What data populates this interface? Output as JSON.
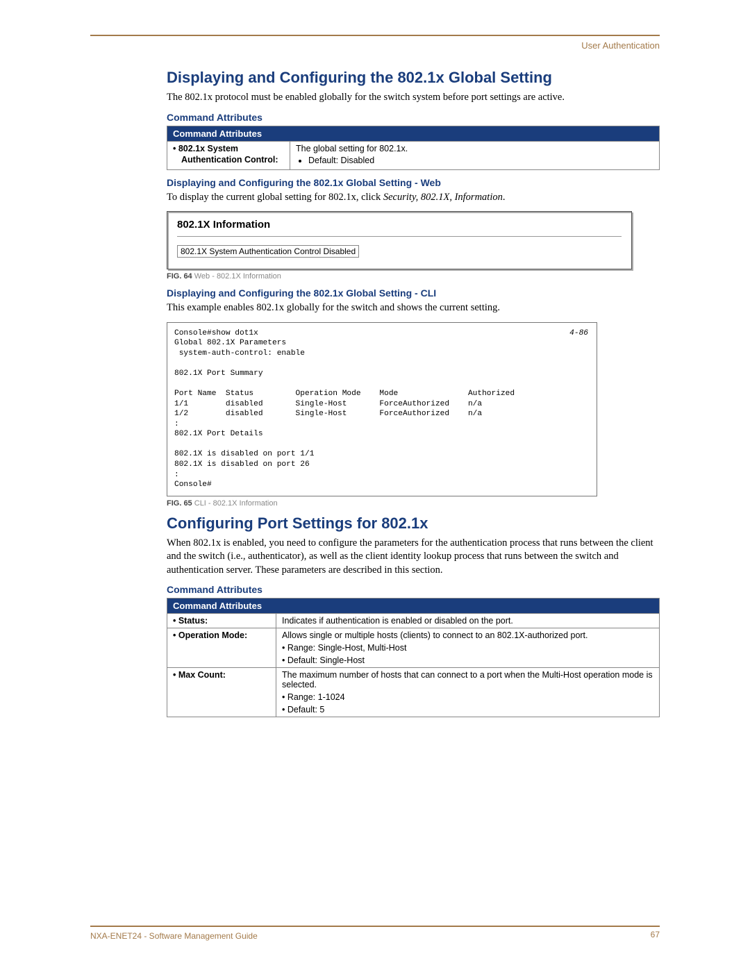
{
  "header": {
    "section": "User Authentication"
  },
  "s1": {
    "title": "Displaying and Configuring the 802.1x Global Setting",
    "intro": "The 802.1x protocol must be enabled globally for the switch system before port settings are active.",
    "attr_heading": "Command Attributes",
    "table_bar": "Command Attributes",
    "row1_key_line1": "• 802.1x System",
    "row1_key_line2": "Authentication Control:",
    "row1_desc": "The global setting for 802.1x.",
    "row1_bullet": "Default: Disabled",
    "web_h": "Displaying and Configuring the 802.1x Global Setting - Web",
    "web_p_before": "To display the current global setting for 802.1x, click ",
    "web_p_em": "Security, 802.1X, Information",
    "web_p_after": ".",
    "fig64": {
      "panel_title": "802.1X Information",
      "field": "802.1X System Authentication Control Disabled",
      "cap_b": "FIG. 64",
      "cap_t": "  Web - 802.1X Information"
    },
    "cli_h": "Displaying and Configuring the 802.1x Global Setting - CLI",
    "cli_p": "This example enables 802.1x globally for the switch and shows the current setting.",
    "cli_code_page": "4-86",
    "cli_lines": "Console#show dot1x\nGlobal 802.1X Parameters\n system-auth-control: enable\n\n802.1X Port Summary\n\nPort Name  Status         Operation Mode    Mode               Authorized\n1/1        disabled       Single-Host       ForceAuthorized    n/a\n1/2        disabled       Single-Host       ForceAuthorized    n/a\n:\n802.1X Port Details\n\n802.1X is disabled on port 1/1\n802.1X is disabled on port 26\n:  \nConsole#",
    "fig65": {
      "cap_b": "FIG. 65",
      "cap_t": "  CLI - 802.1X Information"
    }
  },
  "s2": {
    "title": "Configuring Port Settings for 802.1x",
    "intro": "When 802.1x is enabled, you need to configure the parameters for the authentication process that runs between the client and the switch (i.e., authenticator), as well as the client identity lookup process that runs between the switch and authentication server. These parameters are described in this section.",
    "attr_heading": "Command Attributes",
    "table_bar": "Command Attributes",
    "rows": [
      {
        "key": "• Status:",
        "lines": [
          "Indicates if authentication is enabled or disabled on the port."
        ]
      },
      {
        "key": "• Operation Mode:",
        "lines": [
          "Allows single or multiple hosts (clients) to connect to an 802.1X-authorized port.",
          "• Range: Single-Host, Multi-Host",
          "• Default: Single-Host"
        ]
      },
      {
        "key": "• Max Count:",
        "lines": [
          "The maximum number of hosts that can connect to a port when the Multi-Host operation mode is selected.",
          "• Range: 1-1024",
          "• Default: 5"
        ]
      }
    ]
  },
  "footer": {
    "doc": "NXA-ENET24 - Software Management Guide",
    "page": "67"
  }
}
